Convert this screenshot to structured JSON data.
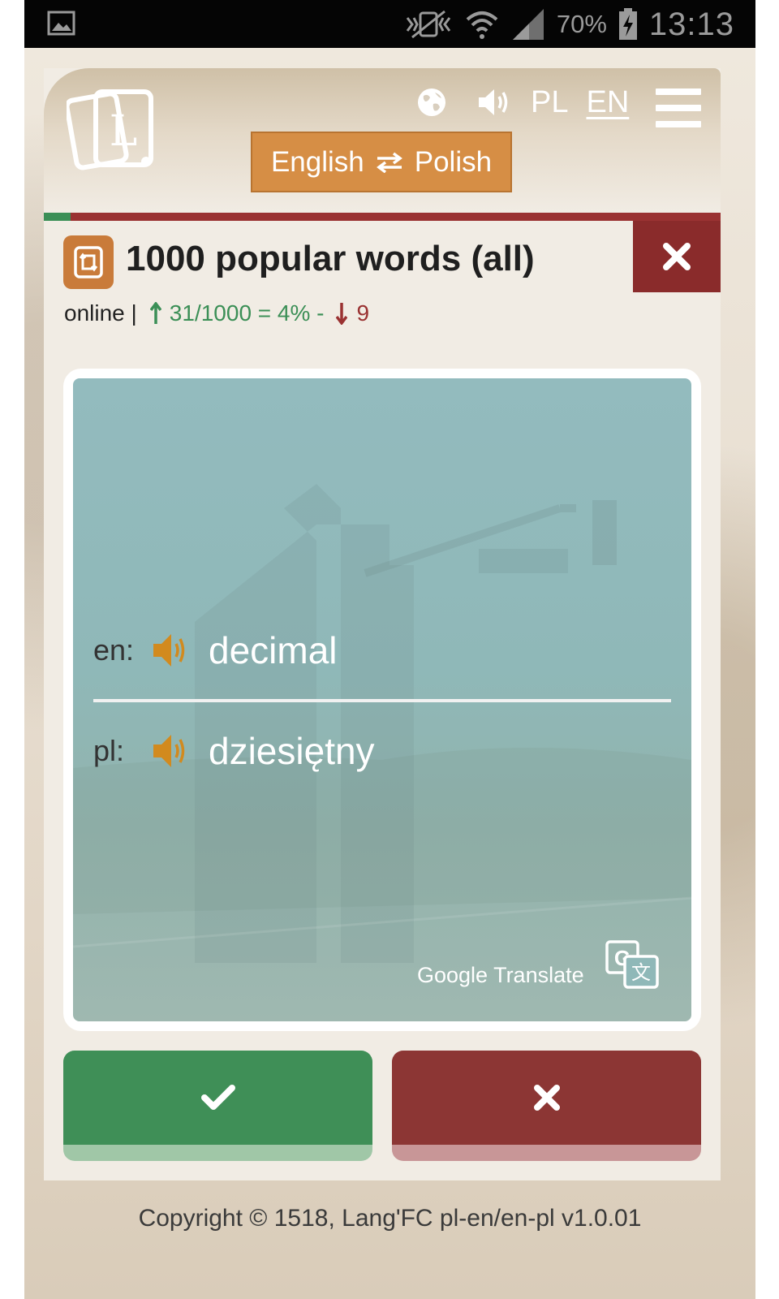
{
  "status_bar": {
    "battery_percent": "70%",
    "time": "13:13"
  },
  "header": {
    "lang_pl": "PL",
    "lang_en": "EN",
    "direction_toggle": {
      "from": "English",
      "to": "Polish"
    }
  },
  "deck": {
    "title": "1000 popular words (all)",
    "mode": "online |",
    "known_stats": "31/1000 = 4% -",
    "unknown_count": "9",
    "progress_fraction": 0.04
  },
  "card": {
    "source_lang_label": "en:",
    "source_word": "decimal",
    "target_lang_label": "pl:",
    "target_word": "dziesiętny",
    "translator_label": "Google Translate"
  },
  "footer": {
    "copyright": "Copyright © 1518, Lang'FC pl-en/en-pl v1.0.01"
  },
  "colors": {
    "accent_orange": "#d68e45",
    "success_green": "#3f8f57",
    "danger_red": "#8c3634",
    "card_teal": "#93bbbe"
  }
}
